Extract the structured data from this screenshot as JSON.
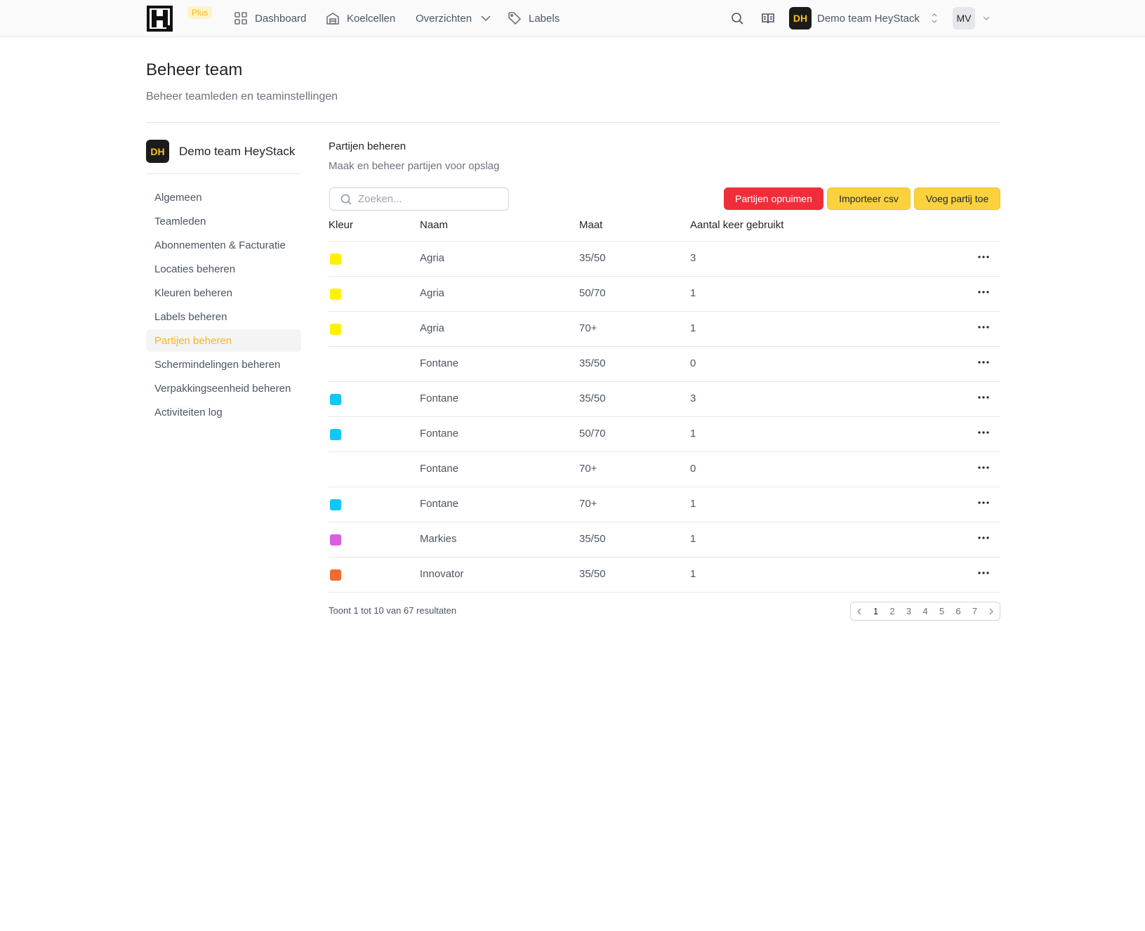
{
  "topbar": {
    "plus_badge": "Plus",
    "nav": [
      {
        "label": "Dashboard",
        "icon": "grid-icon"
      },
      {
        "label": "Koelcellen",
        "icon": "warehouse-icon"
      },
      {
        "label": "Overzichten",
        "icon": "chevron-down-icon"
      },
      {
        "label": "Labels",
        "icon": "tag-icon"
      }
    ],
    "team_initials": "DH",
    "team_name": "Demo team HeyStack",
    "user_initials": "MV"
  },
  "header": {
    "title": "Beheer team",
    "subtitle": "Beheer teamleden en teaminstellingen"
  },
  "sidebar": {
    "team_initials": "DH",
    "team_name": "Demo team HeyStack",
    "items": [
      {
        "label": "Algemeen"
      },
      {
        "label": "Teamleden"
      },
      {
        "label": "Abonnementen & Facturatie"
      },
      {
        "label": "Locaties beheren"
      },
      {
        "label": "Kleuren beheren"
      },
      {
        "label": "Labels beheren"
      },
      {
        "label": "Partijen beheren",
        "active": true
      },
      {
        "label": "Schermindelingen beheren"
      },
      {
        "label": "Verpakkingseenheid beheren"
      },
      {
        "label": "Activiteiten log"
      }
    ]
  },
  "main": {
    "title": "Partijen beheren",
    "subtitle": "Maak en beheer partijen voor opslag",
    "search_placeholder": "Zoeken...",
    "buttons": {
      "cleanup": "Partijen opruimen",
      "import": "Importeer csv",
      "add": "Voeg partij toe"
    },
    "columns": [
      "Kleur",
      "Naam",
      "Maat",
      "Aantal keer gebruikt"
    ],
    "rows": [
      {
        "color": "#fff200",
        "name": "Agria",
        "size": "35/50",
        "used": "3"
      },
      {
        "color": "#fff200",
        "name": "Agria",
        "size": "50/70",
        "used": "1"
      },
      {
        "color": "#fff200",
        "name": "Agria",
        "size": "70+",
        "used": "1"
      },
      {
        "color": "",
        "name": "Fontane",
        "size": "35/50",
        "used": "0"
      },
      {
        "color": "#10c7f5",
        "name": "Fontane",
        "size": "35/50",
        "used": "3"
      },
      {
        "color": "#10c7f5",
        "name": "Fontane",
        "size": "50/70",
        "used": "1"
      },
      {
        "color": "",
        "name": "Fontane",
        "size": "70+",
        "used": "0"
      },
      {
        "color": "#10c7f5",
        "name": "Fontane",
        "size": "70+",
        "used": "1"
      },
      {
        "color": "#d95ee0",
        "name": "Markies",
        "size": "35/50",
        "used": "1"
      },
      {
        "color": "#f26b2e",
        "name": "Innovator",
        "size": "35/50",
        "used": "1"
      }
    ],
    "result_text": "Toont 1 tot 10 van 67 resultaten",
    "pages": [
      "1",
      "2",
      "3",
      "4",
      "5",
      "6",
      "7"
    ],
    "current_page": "1"
  }
}
